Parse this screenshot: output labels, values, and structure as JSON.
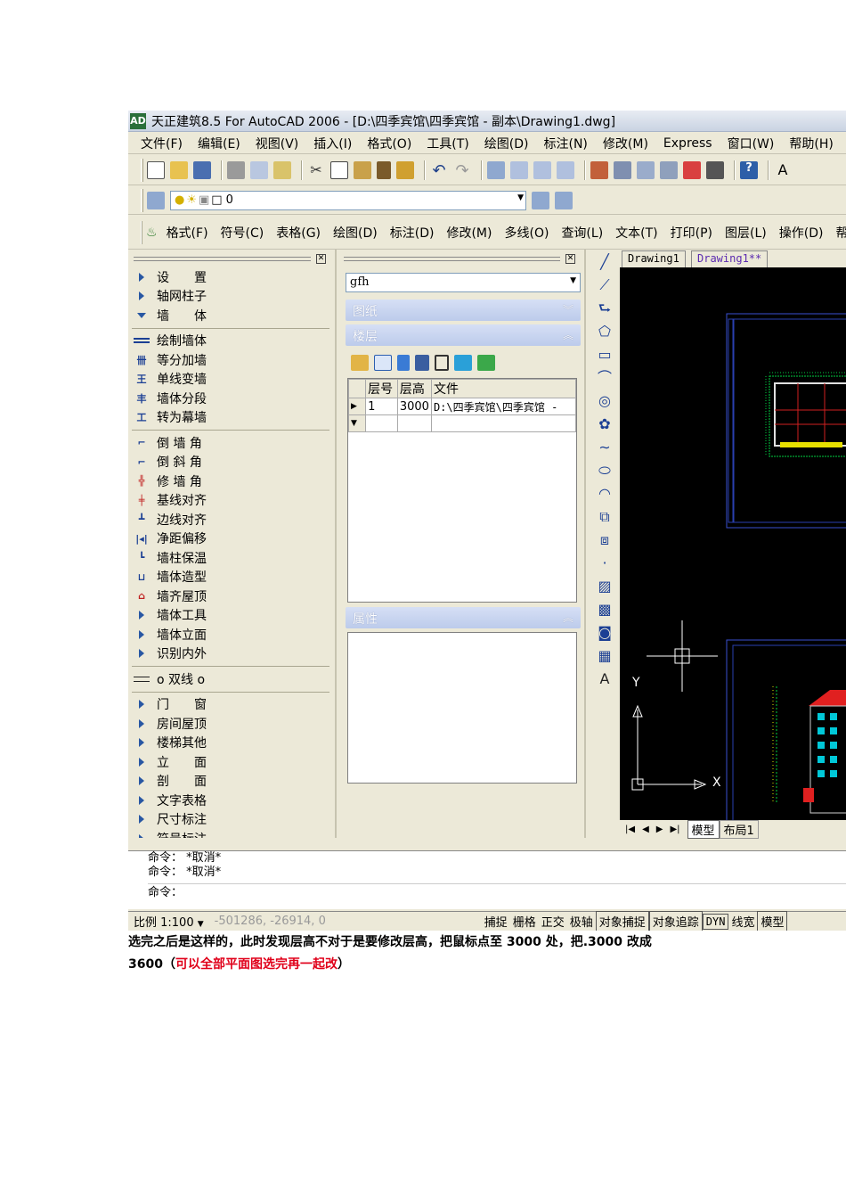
{
  "window": {
    "title": "天正建筑8.5 For AutoCAD 2006 - [D:\\四季宾馆\\四季宾馆 - 副本\\Drawing1.dwg]",
    "logo": "AD"
  },
  "menubar": [
    "文件(F)",
    "编辑(E)",
    "视图(V)",
    "插入(I)",
    "格式(O)",
    "工具(T)",
    "绘图(D)",
    "标注(N)",
    "修改(M)",
    "Express",
    "窗口(W)",
    "帮助(H)"
  ],
  "layer": {
    "value": "0"
  },
  "tzmenu": [
    "格式(F)",
    "符号(C)",
    "表格(G)",
    "绘图(D)",
    "标注(D)",
    "修改(M)",
    "多线(O)",
    "查询(L)",
    "文本(T)",
    "打印(P)",
    "图层(L)",
    "操作(D)",
    "帮助(H)"
  ],
  "left_menu": {
    "top": [
      {
        "label": "设　　置",
        "type": "collapsed"
      },
      {
        "label": "轴网柱子",
        "type": "collapsed"
      },
      {
        "label": "墙　　体",
        "type": "expanded"
      }
    ],
    "wall_items1": [
      "绘制墙体",
      "等分加墙",
      "单线变墙",
      "墙体分段",
      "转为幕墙"
    ],
    "wall_items2": [
      "倒 墙 角",
      "倒 斜 角",
      "修 墙 角",
      "基线对齐",
      "边线对齐",
      "净距偏移",
      "墙柱保温",
      "墙体造型",
      "墙齐屋顶"
    ],
    "wall_sub": [
      "墙体工具",
      "墙体立面",
      "识别内外"
    ],
    "dual_line": "o 双线 o",
    "bottom": [
      "门　　窗",
      "房间屋顶",
      "楼梯其他",
      "立　　面",
      "剖　　面",
      "文字表格",
      "尺寸标注",
      "符号标注"
    ]
  },
  "mid_panel": {
    "combo_value": "gfh",
    "section_drawing": "图纸",
    "section_floor": "楼层",
    "section_props": "属性",
    "table": {
      "headers": [
        "层号",
        "层高",
        "文件"
      ],
      "rows": [
        [
          "1",
          "3000",
          "D:\\四季宾馆\\四季宾馆 -"
        ]
      ]
    }
  },
  "drawing_tabs": [
    "Drawing1",
    "Drawing1**"
  ],
  "model_tabs": [
    "模型",
    "布局1"
  ],
  "axis": {
    "y": "Y",
    "x": "X"
  },
  "command": [
    "命令： *取消*",
    "命令： *取消*",
    "命令："
  ],
  "status": {
    "scale": "比例 1:100",
    "coords": "-501286,  -26914,  0",
    "toggles": [
      "捕捉",
      "栅格",
      "正交",
      "极轴",
      "对象捕捉",
      "对象追踪",
      "DYN",
      "线宽",
      "模型"
    ]
  },
  "caption": {
    "line1": "选完之后是这样的，此时发现层高不对于是要修改层高，把鼠标点至 3000 处，把.3000 改成",
    "line2_black": "3600（",
    "line2_red": "可以全部平面图选完再一起改",
    "line2_end": "）"
  }
}
